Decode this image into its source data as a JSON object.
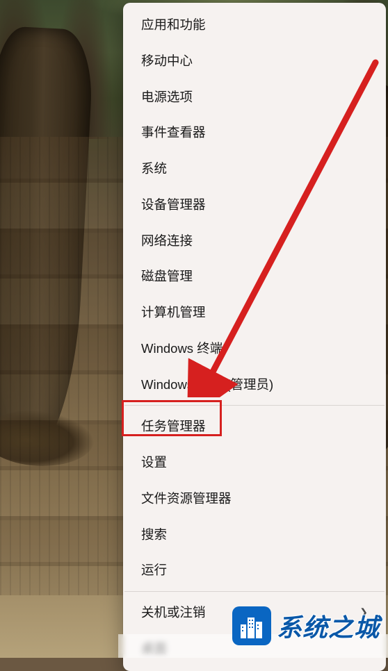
{
  "context_menu": {
    "groups": [
      [
        {
          "id": "apps-features",
          "label": "应用和功能"
        },
        {
          "id": "mobility-center",
          "label": "移动中心"
        },
        {
          "id": "power-options",
          "label": "电源选项"
        },
        {
          "id": "event-viewer",
          "label": "事件查看器"
        },
        {
          "id": "system",
          "label": "系统"
        },
        {
          "id": "device-manager",
          "label": "设备管理器"
        },
        {
          "id": "network-connections",
          "label": "网络连接"
        },
        {
          "id": "disk-management",
          "label": "磁盘管理"
        },
        {
          "id": "computer-management",
          "label": "计算机管理"
        },
        {
          "id": "windows-terminal",
          "label": "Windows 终端"
        },
        {
          "id": "windows-terminal-admin",
          "label": "Windows 终端 (管理员)"
        }
      ],
      [
        {
          "id": "task-manager",
          "label": "任务管理器"
        },
        {
          "id": "settings",
          "label": "设置",
          "highlighted": true
        },
        {
          "id": "file-explorer",
          "label": "文件资源管理器"
        },
        {
          "id": "search",
          "label": "搜索"
        },
        {
          "id": "run",
          "label": "运行"
        }
      ],
      [
        {
          "id": "shutdown-signout",
          "label": "关机或注销",
          "has_submenu": true
        },
        {
          "id": "desktop",
          "label": "桌面"
        }
      ]
    ]
  },
  "annotation": {
    "type": "arrow",
    "color": "#d6201f",
    "targets_item": "settings"
  },
  "watermark": {
    "text": "系统之城",
    "logo_name": "city-buildings-icon",
    "brand_color": "#0a66c2"
  }
}
